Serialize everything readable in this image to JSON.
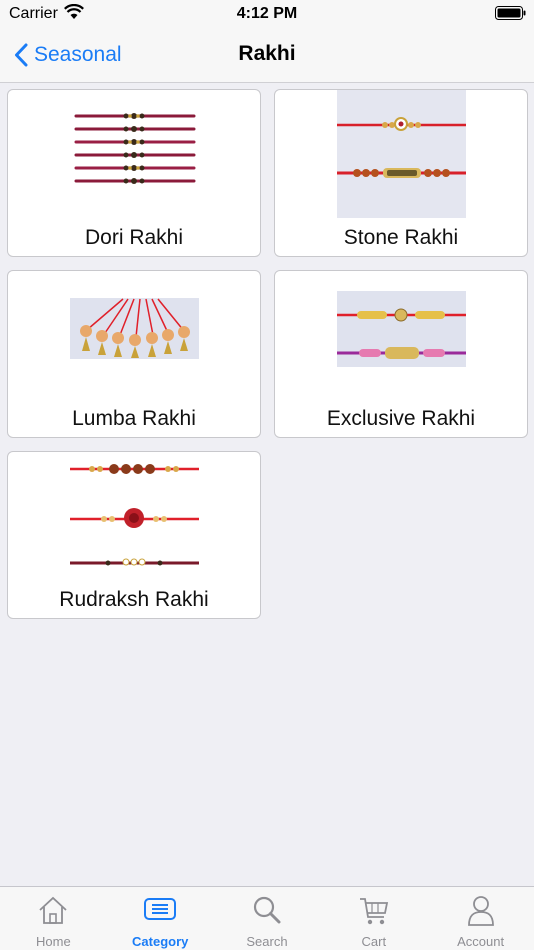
{
  "status": {
    "carrier": "Carrier",
    "time": "4:12 PM"
  },
  "nav": {
    "back_label": "Seasonal",
    "title": "Rakhi"
  },
  "categories": [
    {
      "label": "Dori Rakhi"
    },
    {
      "label": "Stone Rakhi"
    },
    {
      "label": "Lumba Rakhi"
    },
    {
      "label": "Exclusive Rakhi"
    },
    {
      "label": "Rudraksh Rakhi"
    }
  ],
  "tabs": [
    {
      "label": "Home",
      "icon": "home-icon"
    },
    {
      "label": "Category",
      "icon": "category-icon",
      "active": true
    },
    {
      "label": "Search",
      "icon": "search-icon"
    },
    {
      "label": "Cart",
      "icon": "cart-icon"
    },
    {
      "label": "Account",
      "icon": "account-icon"
    }
  ],
  "colors": {
    "accent": "#1a7cf6",
    "inactive": "#8e8e93",
    "background": "#efeff4"
  }
}
